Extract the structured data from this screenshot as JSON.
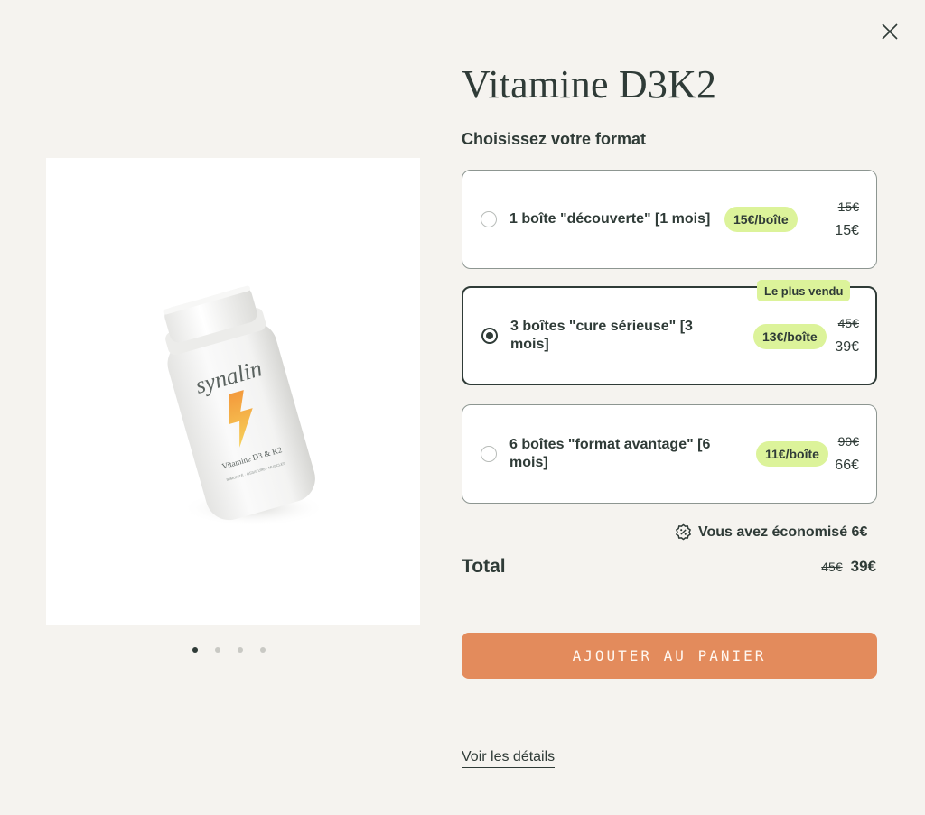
{
  "product": {
    "title": "Vitamine D3K2",
    "image": {
      "brand": "synalin",
      "bottle_label": "Vitamine D3 & K2",
      "bottle_subtitle": "IMMUNITÉ · OSSATURE · MUSCLES"
    },
    "gallery": {
      "dot_count": 4,
      "active_index": 0
    }
  },
  "format": {
    "heading": "Choisissez votre format",
    "best_seller_badge": "Le plus vendu",
    "options": [
      {
        "label": "1 boîte \"découverte\" [1 mois]",
        "per_box": "15€/boîte",
        "old_price": "15€",
        "price": "15€",
        "selected": false
      },
      {
        "label": "3 boîtes \"cure sérieuse\" [3 mois]",
        "per_box": "13€/boîte",
        "old_price": "45€",
        "price": "39€",
        "selected": true
      },
      {
        "label": "6 boîtes \"format avantage\" [6 mois]",
        "per_box": "11€/boîte",
        "old_price": "90€",
        "price": "66€",
        "selected": false
      }
    ]
  },
  "savings": {
    "text": "Vous avez économisé 6€"
  },
  "total": {
    "label": "Total",
    "old_price": "45€",
    "price": "39€"
  },
  "actions": {
    "add_to_cart": "AJOUTER AU PANIER",
    "see_details": "Voir les détails"
  },
  "colors": {
    "background": "#f5f3ef",
    "text": "#2f3b37",
    "accent_button": "#e38b5c",
    "pill": "#dcf39a",
    "bolt_top": "#f39a3c",
    "bolt_bottom": "#f7d15a"
  },
  "icons": {
    "close": "close-icon",
    "savings": "discount-badge-icon"
  }
}
